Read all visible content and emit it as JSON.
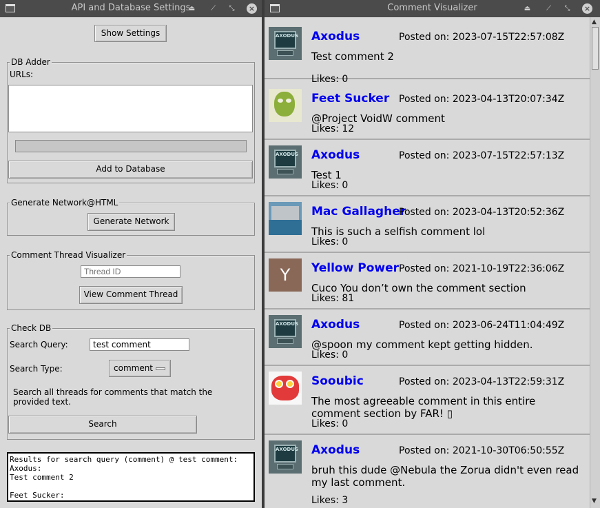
{
  "left_window": {
    "title": "API and Database Settings",
    "show_settings_label": "Show Settings",
    "db_adder": {
      "legend": "DB Adder",
      "urls_label": "URLs:",
      "urls_value": "",
      "progress": 0,
      "add_label": "Add to Database"
    },
    "generate_network": {
      "legend": "Generate Network@HTML",
      "button_label": "Generate Network"
    },
    "thread_visualizer": {
      "legend": "Comment Thread Visualizer",
      "thread_id_placeholder": "Thread ID",
      "view_label": "View Comment Thread"
    },
    "check_db": {
      "legend": "Check DB",
      "query_label": "Search Query:",
      "query_value": "test comment",
      "type_label": "Search Type:",
      "type_value": "comment",
      "description": "Search all threads for comments that match the provided text.",
      "search_label": "Search"
    },
    "results_text": "Results for search query (comment) @ test comment:\nAxodus:\nTest comment 2\n\nFeet Sucker:"
  },
  "right_window": {
    "title": "Comment Visualizer",
    "comments": [
      {
        "author": "Axodus",
        "posted": "Posted on: 2023-07-15T22:57:08Z",
        "text": "Test comment 2",
        "likes": "Likes: 0",
        "avatar": "axodus"
      },
      {
        "author": "Feet Sucker",
        "posted": "Posted on: 2023-04-13T20:07:34Z",
        "text": "@Project VoidW comment",
        "likes": "Likes: 12",
        "avatar": "feet"
      },
      {
        "author": "Axodus",
        "posted": "Posted on: 2023-07-15T22:57:13Z",
        "text": "Test 1",
        "likes": "Likes: 0",
        "avatar": "axodus"
      },
      {
        "author": "Mac Gallagher",
        "posted": "Posted on: 2023-04-13T20:52:36Z",
        "text": "This is such a selfish comment lol",
        "likes": "Likes: 0",
        "avatar": "mac"
      },
      {
        "author": "Yellow Power",
        "posted": "Posted on: 2021-10-19T22:36:06Z",
        "text": "Cuco You don’t own the comment section",
        "likes": "Likes: 81",
        "avatar": "yellow",
        "avatar_letter": "Y"
      },
      {
        "author": "Axodus",
        "posted": "Posted on: 2023-06-24T11:04:49Z",
        "text": "@spoon my comment kept getting hidden.",
        "likes": "Likes: 0",
        "avatar": "axodus"
      },
      {
        "author": "Sooubic",
        "posted": "Posted on: 2023-04-13T22:59:31Z",
        "text": "The most agreeable comment in this entire comment section by FAR! ▯",
        "likes": "Likes: 0",
        "avatar": "sooubic"
      },
      {
        "author": "Axodus",
        "posted": "Posted on: 2021-10-30T06:50:55Z",
        "text": "bruh this dude @Nebula the Zorua didn't even read my last comment.",
        "likes": "Likes: 3",
        "avatar": "axodus"
      }
    ]
  },
  "icons": {
    "window": "window-icon",
    "minimize": "eject-icon",
    "restore": "restore-icon",
    "close": "close-icon",
    "dropdown": "dropdown-indicator-icon"
  },
  "colors": {
    "author_link": "#0000ee",
    "titlebar": "#4b4b4b",
    "panel": "#d9d9d9"
  }
}
